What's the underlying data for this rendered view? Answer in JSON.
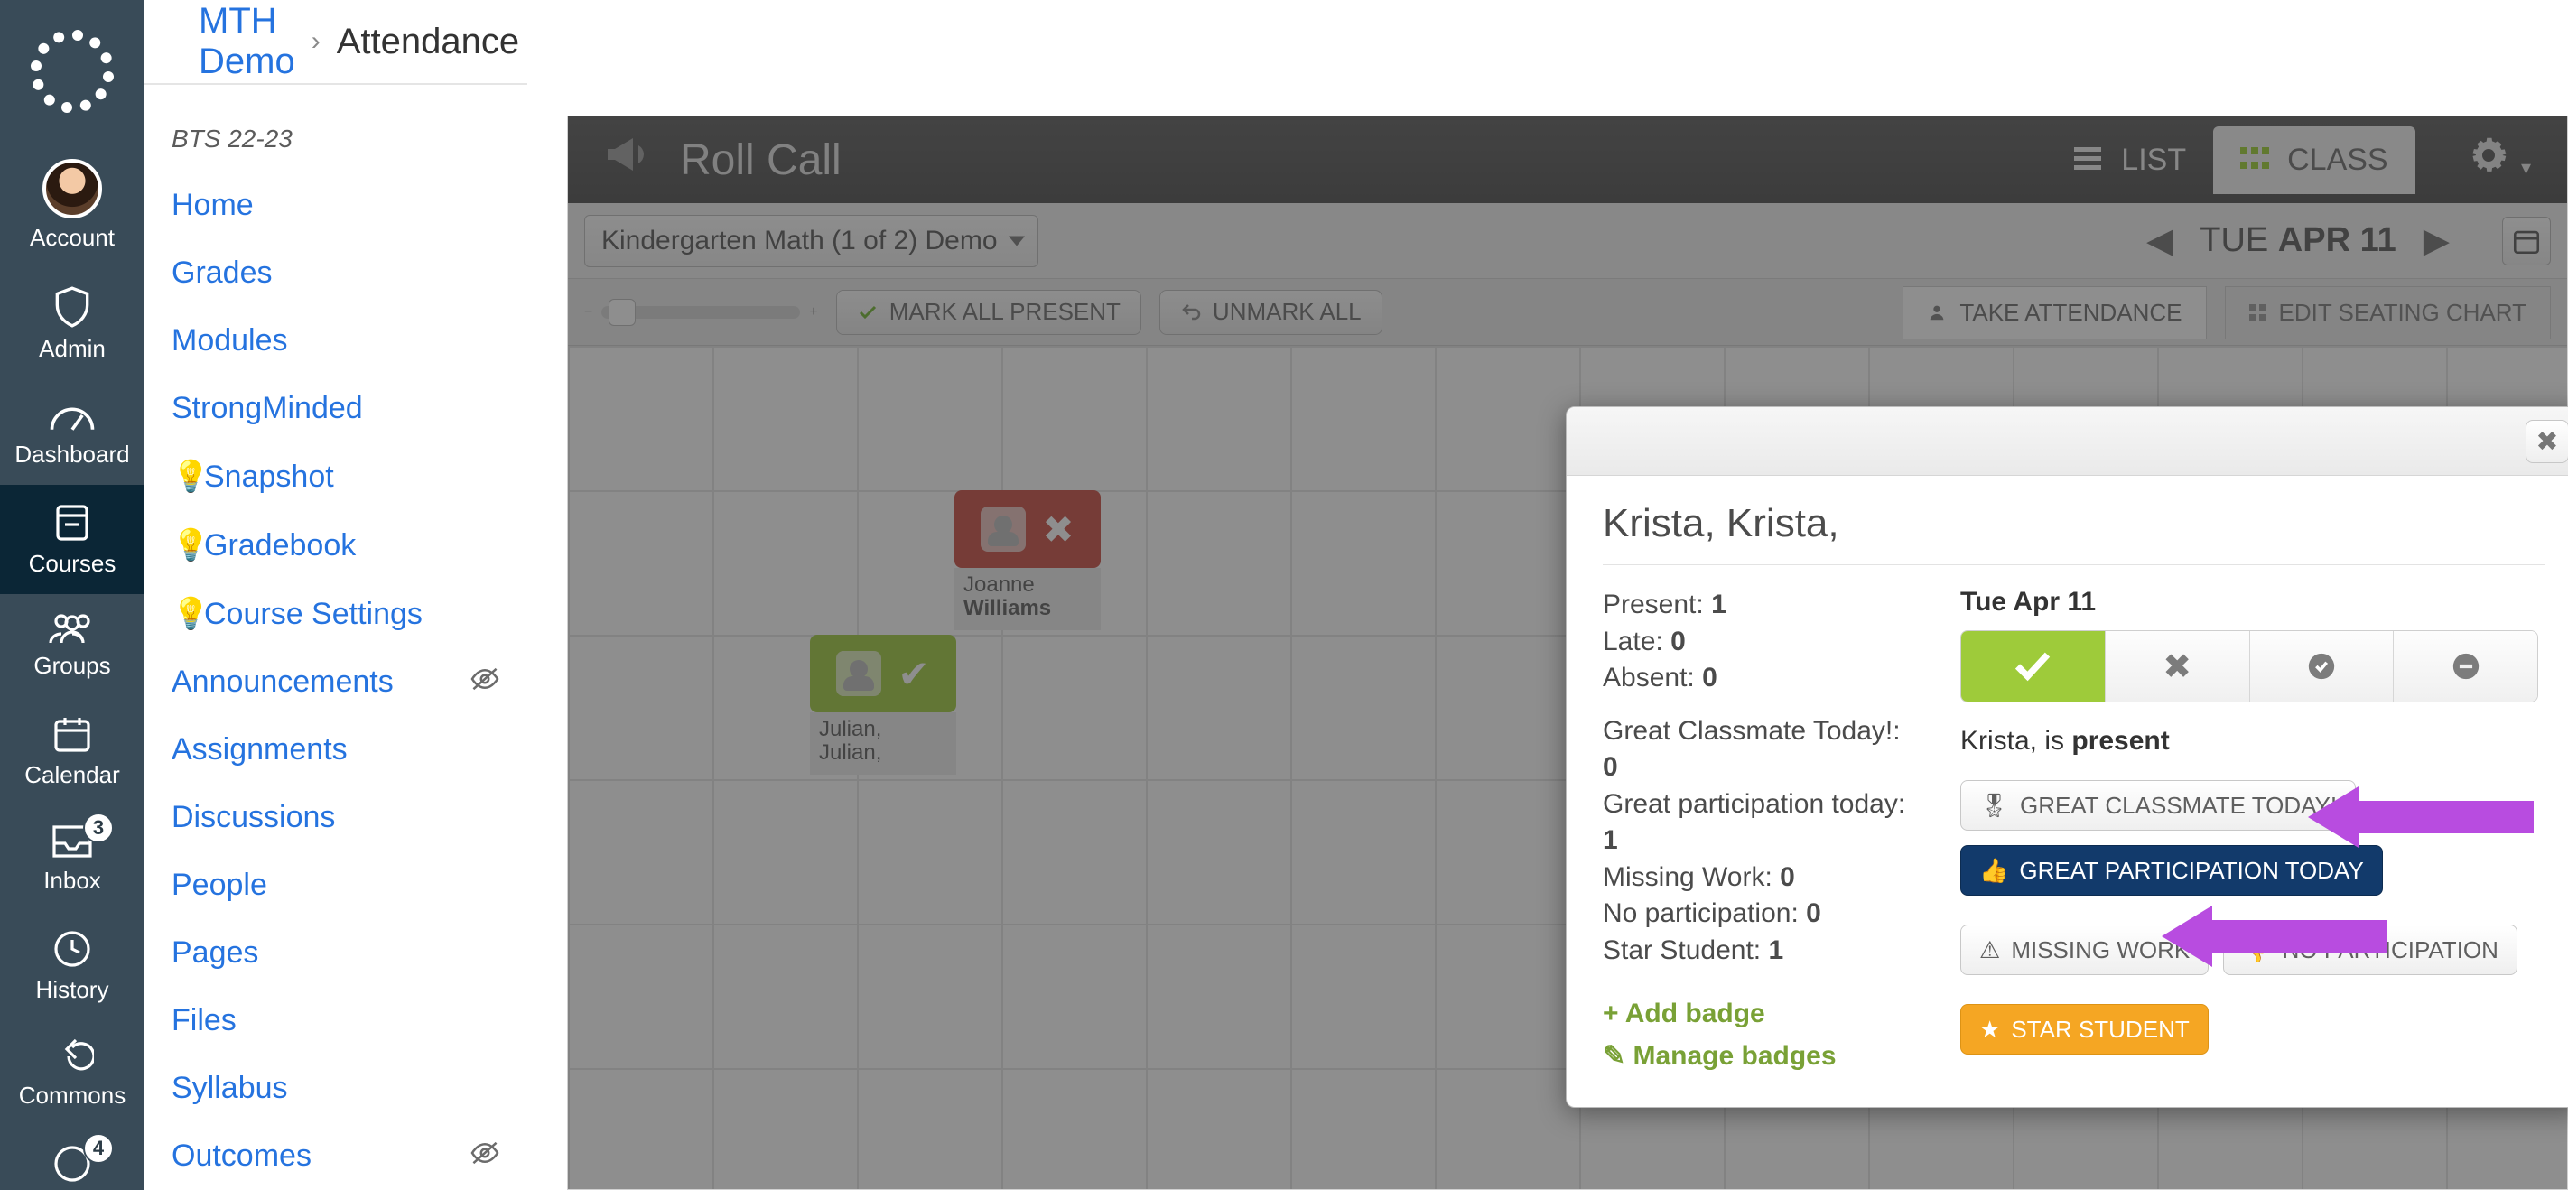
{
  "rail": {
    "items": [
      {
        "id": "account",
        "label": "Account"
      },
      {
        "id": "admin",
        "label": "Admin"
      },
      {
        "id": "dashboard",
        "label": "Dashboard"
      },
      {
        "id": "courses",
        "label": "Courses",
        "selected": true
      },
      {
        "id": "groups",
        "label": "Groups"
      },
      {
        "id": "calendar",
        "label": "Calendar"
      },
      {
        "id": "inbox",
        "label": "Inbox",
        "badge": "3"
      },
      {
        "id": "history",
        "label": "History"
      },
      {
        "id": "commons",
        "label": "Commons"
      },
      {
        "id": "help",
        "label": "",
        "badge": "4"
      }
    ]
  },
  "breadcrumb": {
    "course": "MTH Demo",
    "page": "Attendance"
  },
  "term": "BTS 22-23",
  "course_nav": [
    {
      "label": "Home"
    },
    {
      "label": "Grades"
    },
    {
      "label": "Modules"
    },
    {
      "label": "StrongMinded"
    },
    {
      "label": "Snapshot",
      "bulb": true
    },
    {
      "label": "Gradebook",
      "bulb": true
    },
    {
      "label": "Course Settings",
      "bulb": true
    },
    {
      "label": "Announcements",
      "hidden": true
    },
    {
      "label": "Assignments"
    },
    {
      "label": "Discussions"
    },
    {
      "label": "People"
    },
    {
      "label": "Pages"
    },
    {
      "label": "Files"
    },
    {
      "label": "Syllabus"
    },
    {
      "label": "Outcomes",
      "hidden": true
    }
  ],
  "rollcall": {
    "title": "Roll Call",
    "views": {
      "list": "LIST",
      "class": "CLASS",
      "active": "class"
    },
    "section": "Kindergarten Math (1 of 2) Demo",
    "date_prefix": "TUE",
    "date_main": "APR 11",
    "mark_all": "MARK ALL PRESENT",
    "unmark_all": "UNMARK ALL",
    "tabs": {
      "take": "TAKE ATTENDANCE",
      "edit": "EDIT SEATING CHART",
      "active": "take"
    },
    "seats": [
      {
        "first": "Joanne",
        "last": "Williams",
        "status": "absent"
      },
      {
        "first": "Julian,",
        "last": "Julian,",
        "status": "present"
      }
    ]
  },
  "modal": {
    "student": "Krista, Krista,",
    "stats": {
      "present_label": "Present:",
      "present": "1",
      "late_label": "Late:",
      "late": "0",
      "absent_label": "Absent:",
      "absent": "0",
      "gc_label": "Great Classmate Today!:",
      "gc": "0",
      "gp_label": "Great participation today:",
      "gp": "1",
      "mw_label": "Missing Work:",
      "mw": "0",
      "np_label": "No participation:",
      "np": "0",
      "ss_label": "Star Student:",
      "ss": "1"
    },
    "add_badge": "+ Add badge",
    "manage_badges": "✎ Manage badges",
    "date": "Tue Apr 11",
    "present_line_name": "Krista,",
    "present_line_mid": " is ",
    "present_line_state": "present",
    "badges": {
      "gc": "GREAT CLASSMATE TODAY!",
      "gp": "GREAT PARTICIPATION TODAY",
      "mw": "MISSING WORK",
      "np": "NO PARTICIPATION",
      "ss": "STAR STUDENT"
    }
  }
}
